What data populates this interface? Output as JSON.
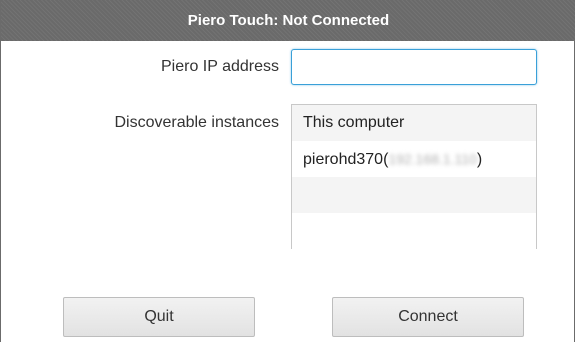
{
  "window": {
    "title": "Piero Touch: Not Connected"
  },
  "form": {
    "ip_label": "Piero IP address",
    "ip_value": "",
    "discover_label": "Discoverable instances",
    "instances": [
      {
        "name": "This computer",
        "address": ""
      },
      {
        "name": "pierohd370(",
        "address": "192.168.1.110",
        "suffix": ")"
      }
    ]
  },
  "buttons": {
    "quit_label": "Quit",
    "connect_label": "Connect"
  },
  "colors": {
    "titlebar": "#6a6a6a",
    "input_focus": "#3aa0d8"
  }
}
